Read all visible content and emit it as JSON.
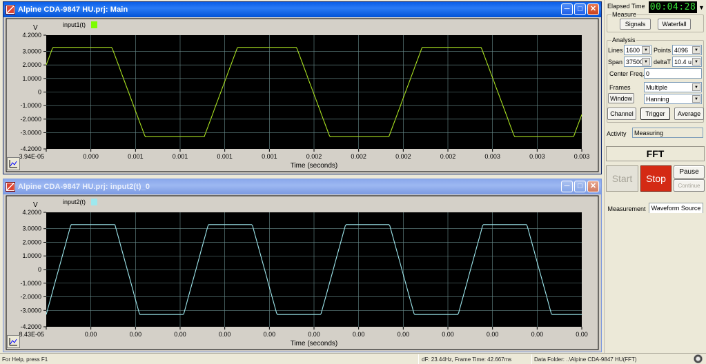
{
  "windows": [
    {
      "title": "Alpine CDA-9847 HU.prj: Main",
      "active": true,
      "chart_data": {
        "type": "line",
        "series": [
          {
            "name": "input1(t)",
            "color": "#a8e020"
          }
        ],
        "legend_swatch": "#7cfc00",
        "ylabel": "V",
        "xlabel": "Time (seconds)",
        "y_ticks": [
          "4.2000",
          "3.0000",
          "2.0000",
          "1.0000",
          "0",
          "-1.0000",
          "-2.0000",
          "-3.0000",
          "-4.2000"
        ],
        "x_ticks": [
          "3.94E-05",
          "0.000",
          "0.001",
          "0.001",
          "0.001",
          "0.001",
          "0.002",
          "0.002",
          "0.002",
          "0.002",
          "0.003",
          "0.003",
          "0.003"
        ],
        "ylim": [
          -4.2,
          4.2
        ],
        "waveform": {
          "shape": "trapezoid",
          "high": 3.3,
          "low": -3.3,
          "cycles_visible": 2.9,
          "start_level": 2.0,
          "start_direction": "rising"
        },
        "grid": true
      }
    },
    {
      "title": "Alpine CDA-9847 HU.prj: input2(t)_0",
      "active": false,
      "chart_data": {
        "type": "line",
        "series": [
          {
            "name": "input2(t)",
            "color": "#9ee8ee"
          }
        ],
        "legend_swatch": "#9ee8ee",
        "ylabel": "V",
        "xlabel": "Time (seconds)",
        "y_ticks": [
          "4.2000",
          "3.0000",
          "2.0000",
          "1.0000",
          "0",
          "-1.0000",
          "-2.0000",
          "-3.0000",
          "-4.2000"
        ],
        "x_ticks": [
          "8.43E-05",
          "0.00",
          "0.00",
          "0.00",
          "0.00",
          "0.00",
          "0.00",
          "0.00",
          "0.00",
          "0.00",
          "0.00",
          "0.00",
          "0.00"
        ],
        "ylim": [
          -4.2,
          4.2
        ],
        "waveform": {
          "shape": "trapezoid",
          "high": 3.3,
          "low": -3.3,
          "cycles_visible": 3.9,
          "start_level": -3.3,
          "start_direction": "rising"
        },
        "grid": true
      }
    }
  ],
  "panel": {
    "elapsed_label": "Elapsed Time",
    "elapsed_value": "00:04:28",
    "measure_legend": "Measure",
    "signals_btn": "Signals",
    "waterfall_btn": "Waterfall",
    "analysis_legend": "Analysis",
    "lines_label": "Lines",
    "lines_value": "1600",
    "points_label": "Points",
    "points_value": "4096",
    "span_label": "Span",
    "span_value": "37500",
    "deltat_label": "deltaT",
    "deltat_value": "10.4 u",
    "center_freq_label": "Center Freq.",
    "center_freq_value": "0",
    "frames_label": "Frames",
    "frames_value": "Multiple",
    "window_btn": "Window",
    "window_value": "Hanning",
    "channel_btn": "Channel",
    "trigger_btn": "Trigger",
    "average_btn": "Average",
    "activity_label": "Activity",
    "activity_value": "Measuring",
    "fft_label": "FFT",
    "start_btn": "Start",
    "stop_btn": "Stop",
    "pause_btn": "Pause",
    "continue_btn": "Continue",
    "tab_measurement": "Measurement",
    "tab_waveform_source": "Waveform Source",
    "stop_color": "#d42a14"
  },
  "status": {
    "help": "For Help, press F1",
    "df_frame": "dF: 23.44Hz, Frame Time: 42.667ms",
    "data_folder": "Data Folder: ..\\Alpine CDA-9847 HU(FFT)"
  }
}
